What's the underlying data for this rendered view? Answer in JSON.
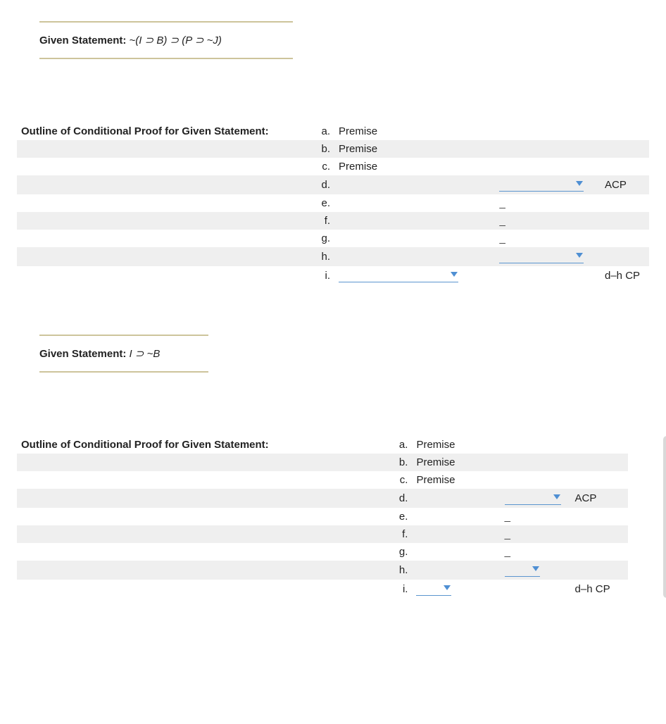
{
  "block1": {
    "given_label": "Given Statement:",
    "given_expr": "~(I ⊃ B) ⊃ (P ⊃ ~J)",
    "outline_head": "Outline of Conditional Proof for Given Statement:",
    "rows": [
      {
        "label": "a.",
        "text": "Premise",
        "shade": false
      },
      {
        "label": "b.",
        "text": "Premise",
        "shade": true
      },
      {
        "label": "c.",
        "text": "Premise",
        "shade": false
      },
      {
        "label": "d.",
        "dd1_wide": true,
        "right": "ACP",
        "shade": true
      },
      {
        "label": "e.",
        "dash": "_",
        "shade": false
      },
      {
        "label": "f.",
        "dash": "_",
        "shade": true
      },
      {
        "label": "g.",
        "dash": "_",
        "shade": false
      },
      {
        "label": "h.",
        "dd1_wide": true,
        "shade": true
      },
      {
        "label": "i.",
        "dd_left": true,
        "right": "d–h CP",
        "shade": false
      }
    ]
  },
  "block2": {
    "given_label": "Given Statement:",
    "given_expr": "I ⊃ ~B",
    "outline_head": "Outline of Conditional Proof for Given Statement:",
    "rows": [
      {
        "label": "a.",
        "text": "Premise",
        "shade": false
      },
      {
        "label": "b.",
        "text": "Premise",
        "shade": true
      },
      {
        "label": "c.",
        "text": "Premise",
        "shade": false
      },
      {
        "label": "d.",
        "dd1_med": true,
        "right": "ACP",
        "shade": true
      },
      {
        "label": "e.",
        "dash": "_",
        "shade": false
      },
      {
        "label": "f.",
        "dash": "_",
        "shade": true
      },
      {
        "label": "g.",
        "dash": "_",
        "shade": false
      },
      {
        "label": "h.",
        "dd1_small": true,
        "shade": true
      },
      {
        "label": "i.",
        "dd_left_small": true,
        "right": "d–h CP",
        "shade": false
      }
    ]
  }
}
